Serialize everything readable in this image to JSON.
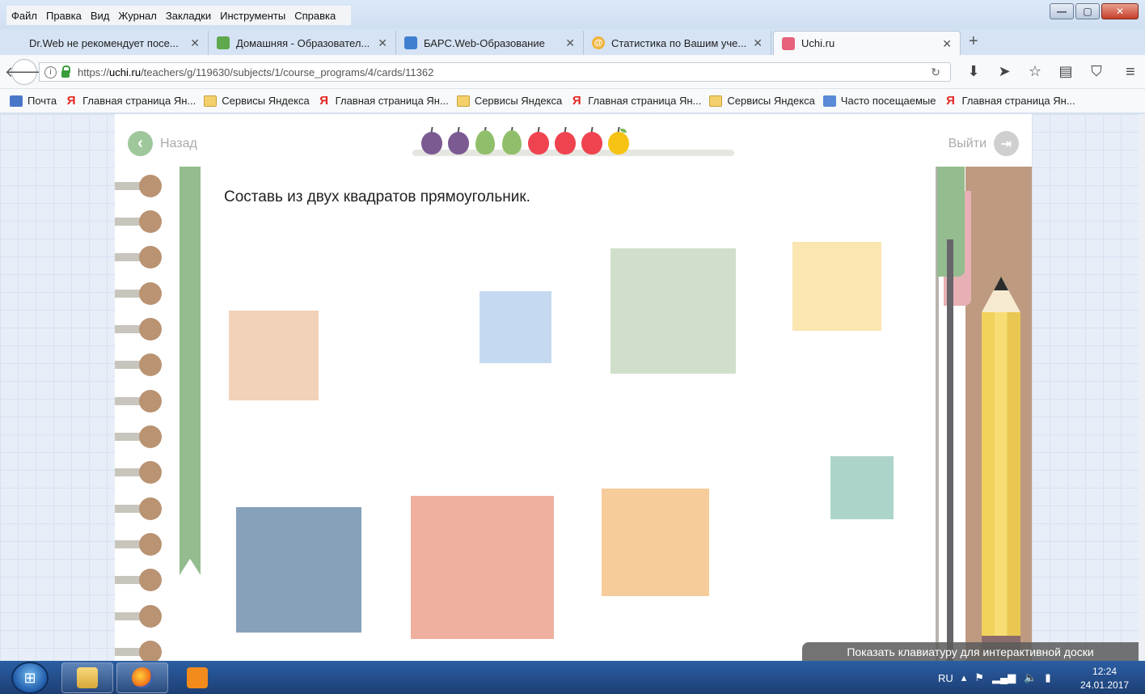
{
  "window": {
    "menu": [
      "Файл",
      "Правка",
      "Вид",
      "Журнал",
      "Закладки",
      "Инструменты",
      "Справка"
    ],
    "controls": {
      "minimize": "—",
      "maximize": "▢",
      "close": "✕"
    }
  },
  "tabs": [
    {
      "label": "Dr.Web не рекомендует посе...",
      "icon": "drweb-icon",
      "active": false
    },
    {
      "label": "Домашняя - Образовател...",
      "icon": "edu-icon",
      "active": false
    },
    {
      "label": "БАРС.Web-Образование",
      "icon": "bars-icon",
      "active": false
    },
    {
      "label": "Статистика по Вашим уче...",
      "icon": "stats-icon",
      "active": false
    },
    {
      "label": "Uchi.ru",
      "icon": "uchi-icon",
      "active": true
    }
  ],
  "new_tab": "+",
  "address": {
    "url_prefix": "https://",
    "url_host": "uchi.ru",
    "url_path": "/teachers/g/119630/subjects/1/course_programs/4/cards/11362"
  },
  "bookmarks": [
    {
      "label": "Почта",
      "icon": "mail-icon"
    },
    {
      "label": "Главная страница Ян...",
      "icon": "yandex-icon"
    },
    {
      "label": "Сервисы Яндекса",
      "icon": "folder-icon"
    },
    {
      "label": "Главная страница Ян...",
      "icon": "yandex-icon"
    },
    {
      "label": "Сервисы Яндекса",
      "icon": "folder-icon"
    },
    {
      "label": "Главная страница Ян...",
      "icon": "yandex-icon"
    },
    {
      "label": "Сервисы Яндекса",
      "icon": "folder-icon"
    },
    {
      "label": "Часто посещаемые",
      "icon": "frequent-icon"
    },
    {
      "label": "Главная страница Ян...",
      "icon": "yandex-icon"
    }
  ],
  "lesson": {
    "back_label": "Назад",
    "exit_label": "Выйти",
    "task": "Составь из двух квадратов прямоугольник.",
    "progress_fruits": [
      {
        "kind": "plum",
        "color": "#7b5a92"
      },
      {
        "kind": "plum",
        "color": "#7b5a92"
      },
      {
        "kind": "pear",
        "color": "#8fbf6a"
      },
      {
        "kind": "pear",
        "color": "#8fbf6a"
      },
      {
        "kind": "apple",
        "color": "#ef4450"
      },
      {
        "kind": "apple",
        "color": "#ef4450"
      },
      {
        "kind": "apple",
        "color": "#ef4450"
      },
      {
        "kind": "apple",
        "color": "#f6c315"
      }
    ],
    "squares": [
      {
        "name": "square-peach",
        "color": "#f2d2b9"
      },
      {
        "name": "square-light-blue",
        "color": "#c5daf0"
      },
      {
        "name": "square-sage",
        "color": "#cfdfcb"
      },
      {
        "name": "square-light-yellow",
        "color": "#fbe6b2"
      },
      {
        "name": "square-teal",
        "color": "#add4cb"
      },
      {
        "name": "square-steel-blue",
        "color": "#87a1bb"
      },
      {
        "name": "square-salmon",
        "color": "#efb0a0"
      },
      {
        "name": "square-apricot",
        "color": "#f6cc9b"
      }
    ]
  },
  "keyboard_hint": "Показать клавиатуру для интерактивной доски",
  "taskbar": {
    "language": "RU",
    "time": "12:24",
    "date": "24.01.2017"
  }
}
